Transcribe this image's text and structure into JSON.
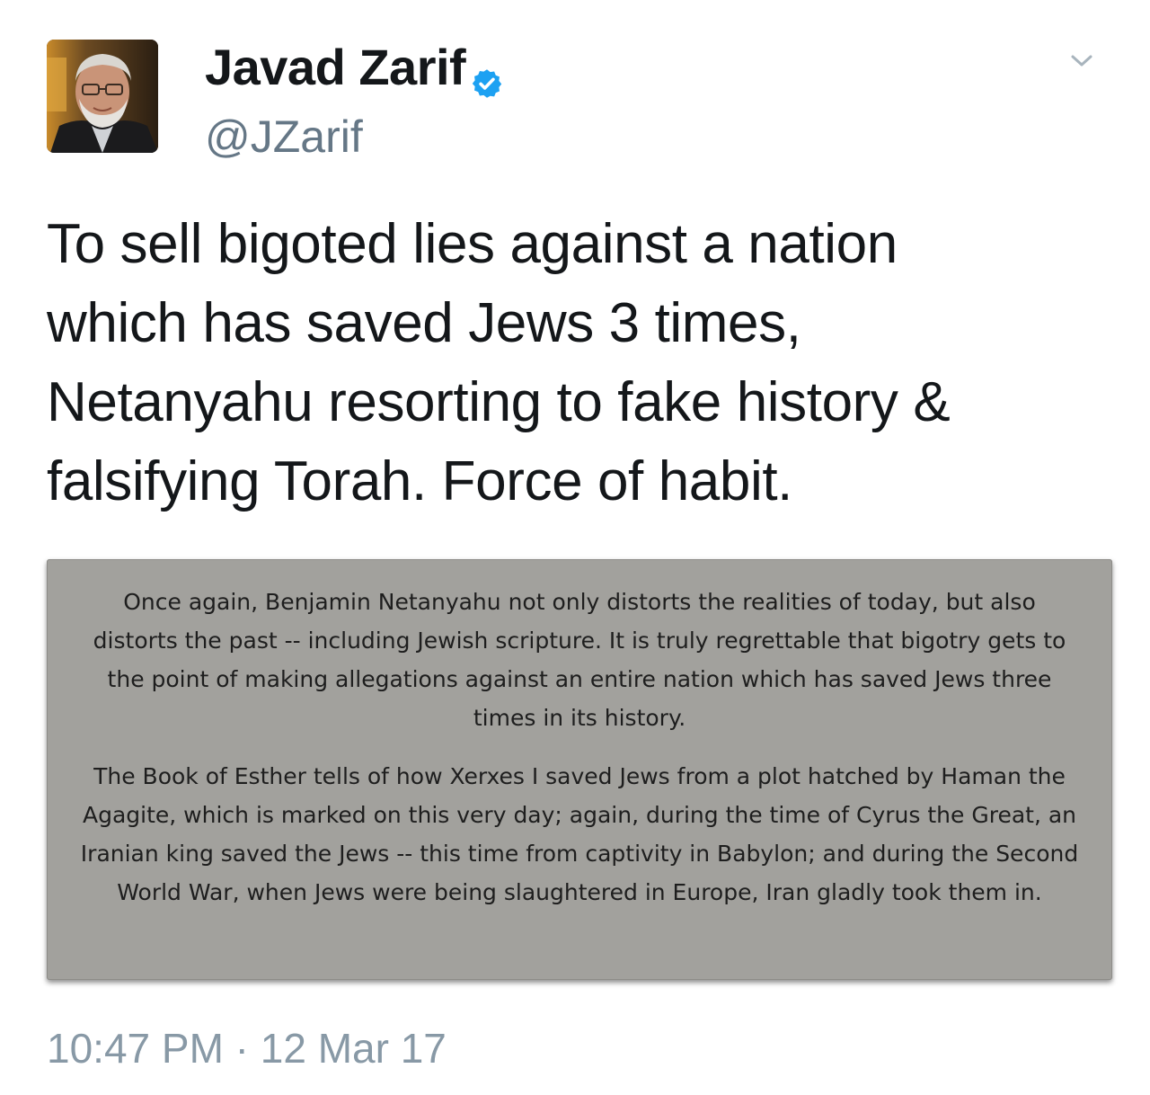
{
  "author": {
    "display_name": "Javad Zarif",
    "handle": "@JZarif",
    "verified": true,
    "verified_color": "#1da1f2"
  },
  "icons": {
    "verified": "verified-badge-icon",
    "caret": "chevron-down-icon",
    "avatar": "profile-photo"
  },
  "tweet": {
    "lines": [
      "To sell bigoted lies against a nation",
      "which has saved Jews 3 times,",
      "Netanyahu resorting to fake history &",
      "falsifying Torah. Force of habit."
    ]
  },
  "media": {
    "paragraph1": [
      "Once again, Benjamin Netanyahu not only distorts the realities of today, but also",
      "distorts the past -- including Jewish scripture. It is truly regrettable that bigotry gets to",
      "the point of making allegations against an entire nation which has saved Jews three",
      "times in its history."
    ],
    "paragraph2": [
      "The Book of Esther tells of how Xerxes I saved Jews from a plot hatched by Haman the",
      "Agagite, which is marked on this very day; again, during the time of Cyrus the Great, an",
      "Iranian king saved the Jews -- this time from captivity in Babylon; and during the Second",
      "World War, when Jews were being slaughtered in Europe, Iran gladly took them in."
    ],
    "background_color": "#a2a19d"
  },
  "timestamp": "10:47 PM · 12 Mar 17"
}
